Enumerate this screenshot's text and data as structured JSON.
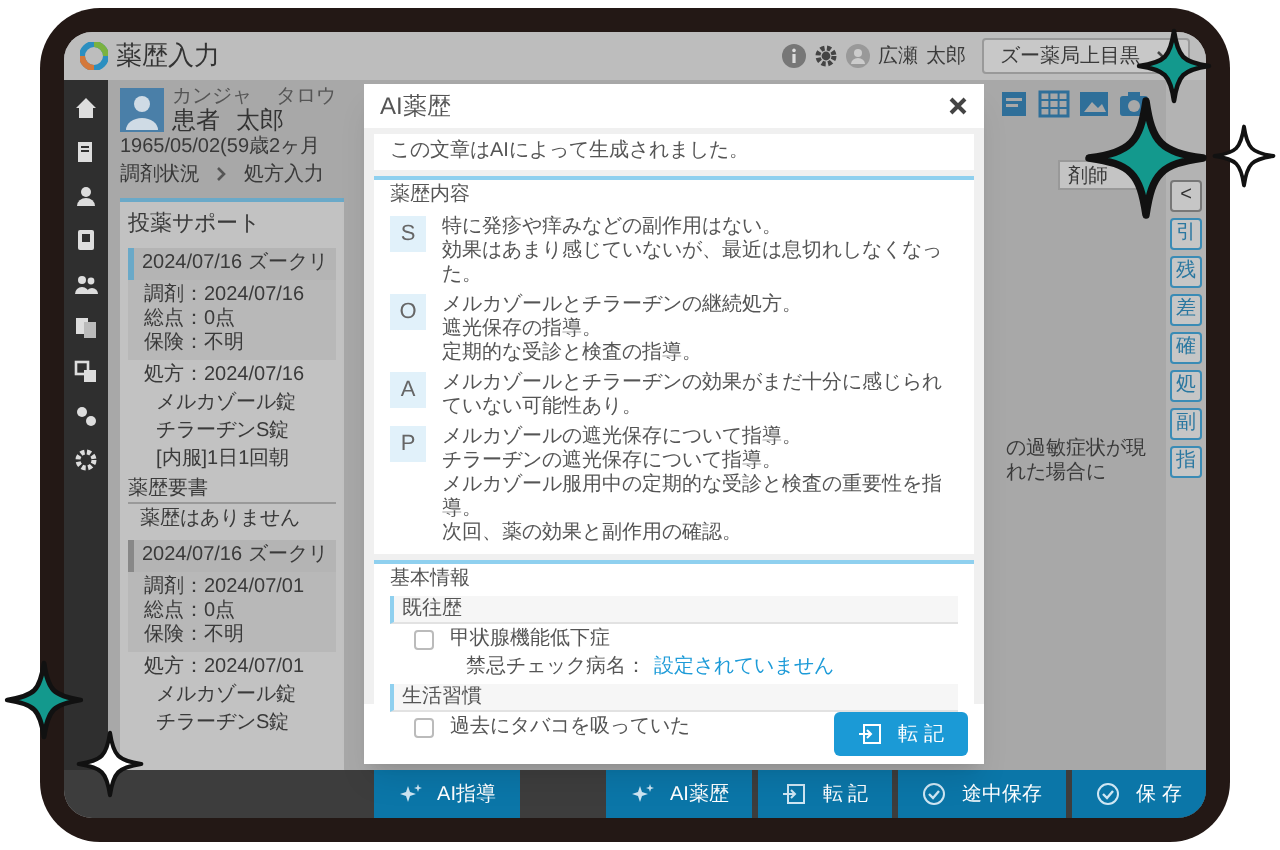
{
  "app": {
    "title": "薬歴入力",
    "user_family": "広瀬",
    "user_given": "太郎",
    "store": "ズー薬局上目黒"
  },
  "patient": {
    "furigana": [
      "カンジャ",
      "タロウ"
    ],
    "name": [
      "患者",
      "太郎"
    ],
    "birth": "1965/05/02(59歳2ヶ月"
  },
  "breadcrumb": [
    "調剤状況",
    "処方入力"
  ],
  "support": {
    "title": "投薬サポート",
    "visits": [
      {
        "header": "2024/07/16 ズークリ",
        "selected": true,
        "info": [
          "調剤：2024/07/16",
          "総点：0点",
          "保険：不明"
        ],
        "rx": "処方：2024/07/16",
        "drugs": [
          "メルカゾール錠",
          "チラーヂンS錠",
          "[内服]1日1回朝"
        ],
        "notes_title": "薬歴要書",
        "notes": "薬歴はありません"
      },
      {
        "header": "2024/07/16 ズークリ",
        "selected": false,
        "info": [
          "調剤：2024/07/01",
          "総点：0点",
          "保険：不明"
        ],
        "rx": "処方：2024/07/01",
        "drugs": [
          "メルカゾール錠",
          "チラーヂンS錠"
        ]
      }
    ]
  },
  "right_panel": {
    "field": "剤師",
    "text": "の過敏症状が現れた場合に"
  },
  "side_rail": [
    "<",
    "引",
    "残",
    "差",
    "確",
    "処",
    "副",
    "指"
  ],
  "bottom_bar": [
    {
      "label": "AI指導",
      "kind": "ai"
    },
    {
      "label": "AI薬歴",
      "kind": "ai"
    },
    {
      "label": "転 記",
      "kind": "transfer"
    },
    {
      "label": "途中保存",
      "kind": "save"
    },
    {
      "label": "保 存",
      "kind": "save"
    }
  ],
  "modal": {
    "title": "AI薬歴",
    "notice": "この文章はAIによって生成されました。",
    "soap_title": "薬歴内容",
    "soap": [
      {
        "letter": "S",
        "lines": [
          "特に発疹や痒みなどの副作用はない。",
          "効果はあまり感じていないが、最近は息切れしなくなった。"
        ]
      },
      {
        "letter": "O",
        "lines": [
          "メルカゾールとチラーヂンの継続処方。",
          "遮光保存の指導。",
          "定期的な受診と検査の指導。"
        ]
      },
      {
        "letter": "A",
        "lines": [
          "メルカゾールとチラーヂンの効果がまだ十分に感じられていない可能性あり。"
        ]
      },
      {
        "letter": "P",
        "lines": [
          "メルカゾールの遮光保存について指導。",
          "チラーヂンの遮光保存について指導。",
          "メルカゾール服用中の定期的な受診と検査の重要性を指導。",
          "次回、薬の効果と副作用の確認。"
        ]
      }
    ],
    "basic_title": "基本情報",
    "groups": [
      {
        "title": "既往歴",
        "items": [
          {
            "label": "甲状腺機能低下症",
            "checked": false,
            "detail_label": "禁忌チェック病名：",
            "detail_value": "設定されていません"
          }
        ]
      },
      {
        "title": "生活習慣",
        "items": [
          {
            "label": "過去にタバコを吸っていた",
            "checked": false
          }
        ]
      }
    ],
    "action": "転 記"
  }
}
